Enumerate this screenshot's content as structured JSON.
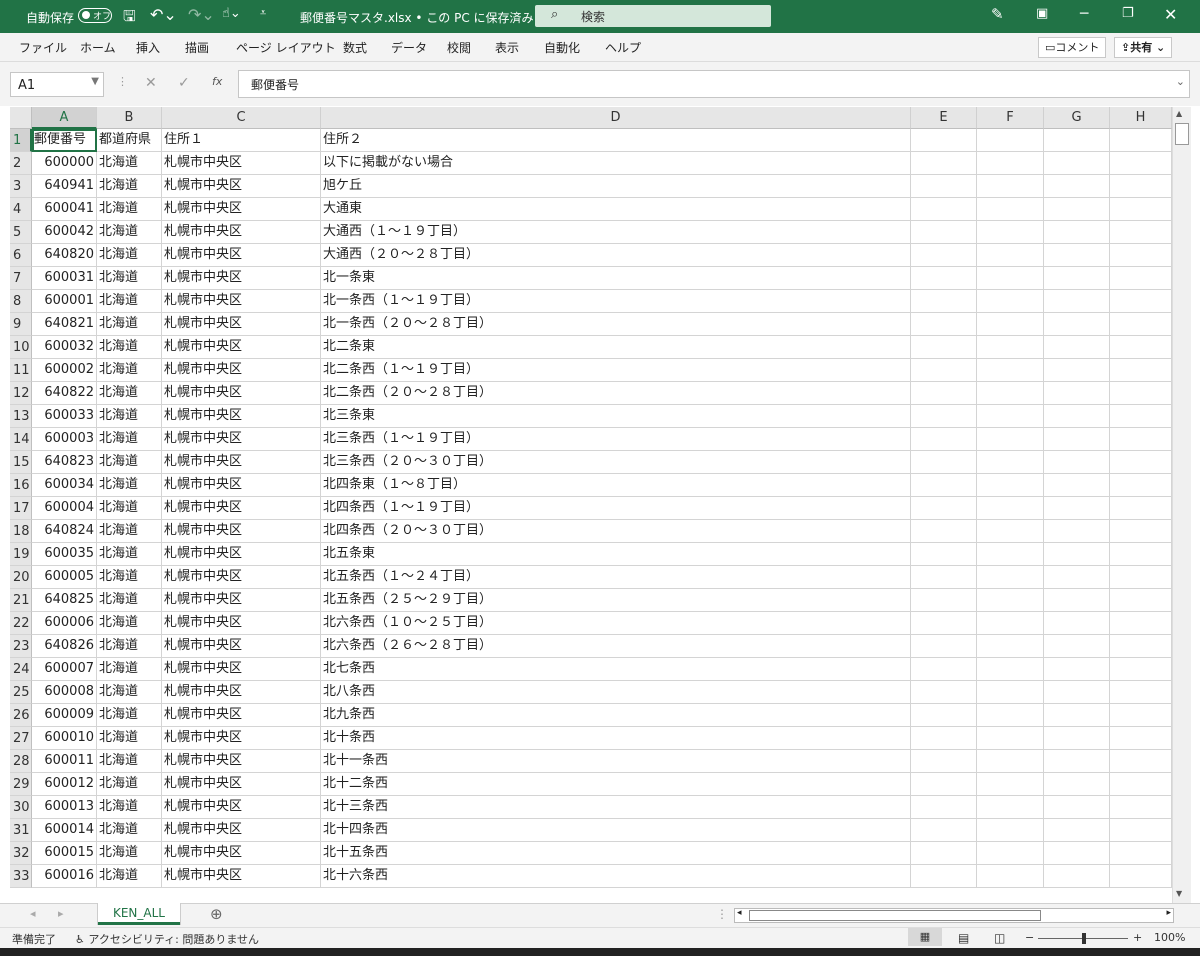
{
  "titlebar": {
    "autosave_label": "自動保存",
    "autosave_state": "オフ",
    "file_title": "郵便番号マスタ.xlsx • この PC に保存済み ⌄",
    "search_placeholder": "検索"
  },
  "ribbon": {
    "menus": [
      "ファイル",
      "ホーム",
      "挿入",
      "描画",
      "ページ レイアウト",
      "数式",
      "データ",
      "校閲",
      "表示",
      "自動化",
      "ヘルプ"
    ],
    "comment_label": "コメント",
    "share_label": "共有"
  },
  "formula_bar": {
    "name_box": "A1",
    "formula": "郵便番号",
    "fx": "fx"
  },
  "columns": [
    "A",
    "B",
    "C",
    "D",
    "E",
    "F",
    "G",
    "H"
  ],
  "selected_cell": "A1",
  "rows": [
    [
      "郵便番号",
      "都道府県",
      "住所１",
      "住所２"
    ],
    [
      "600000",
      "北海道",
      "札幌市中央区",
      "以下に掲載がない場合"
    ],
    [
      "640941",
      "北海道",
      "札幌市中央区",
      "旭ケ丘"
    ],
    [
      "600041",
      "北海道",
      "札幌市中央区",
      "大通東"
    ],
    [
      "600042",
      "北海道",
      "札幌市中央区",
      "大通西（１〜１９丁目）"
    ],
    [
      "640820",
      "北海道",
      "札幌市中央区",
      "大通西（２０〜２８丁目）"
    ],
    [
      "600031",
      "北海道",
      "札幌市中央区",
      "北一条東"
    ],
    [
      "600001",
      "北海道",
      "札幌市中央区",
      "北一条西（１〜１９丁目）"
    ],
    [
      "640821",
      "北海道",
      "札幌市中央区",
      "北一条西（２０〜２８丁目）"
    ],
    [
      "600032",
      "北海道",
      "札幌市中央区",
      "北二条東"
    ],
    [
      "600002",
      "北海道",
      "札幌市中央区",
      "北二条西（１〜１９丁目）"
    ],
    [
      "640822",
      "北海道",
      "札幌市中央区",
      "北二条西（２０〜２８丁目）"
    ],
    [
      "600033",
      "北海道",
      "札幌市中央区",
      "北三条東"
    ],
    [
      "600003",
      "北海道",
      "札幌市中央区",
      "北三条西（１〜１９丁目）"
    ],
    [
      "640823",
      "北海道",
      "札幌市中央区",
      "北三条西（２０〜３０丁目）"
    ],
    [
      "600034",
      "北海道",
      "札幌市中央区",
      "北四条東（１〜８丁目）"
    ],
    [
      "600004",
      "北海道",
      "札幌市中央区",
      "北四条西（１〜１９丁目）"
    ],
    [
      "640824",
      "北海道",
      "札幌市中央区",
      "北四条西（２０〜３０丁目）"
    ],
    [
      "600035",
      "北海道",
      "札幌市中央区",
      "北五条東"
    ],
    [
      "600005",
      "北海道",
      "札幌市中央区",
      "北五条西（１〜２４丁目）"
    ],
    [
      "640825",
      "北海道",
      "札幌市中央区",
      "北五条西（２５〜２９丁目）"
    ],
    [
      "600006",
      "北海道",
      "札幌市中央区",
      "北六条西（１０〜２５丁目）"
    ],
    [
      "640826",
      "北海道",
      "札幌市中央区",
      "北六条西（２６〜２８丁目）"
    ],
    [
      "600007",
      "北海道",
      "札幌市中央区",
      "北七条西"
    ],
    [
      "600008",
      "北海道",
      "札幌市中央区",
      "北八条西"
    ],
    [
      "600009",
      "北海道",
      "札幌市中央区",
      "北九条西"
    ],
    [
      "600010",
      "北海道",
      "札幌市中央区",
      "北十条西"
    ],
    [
      "600011",
      "北海道",
      "札幌市中央区",
      "北十一条西"
    ],
    [
      "600012",
      "北海道",
      "札幌市中央区",
      "北十二条西"
    ],
    [
      "600013",
      "北海道",
      "札幌市中央区",
      "北十三条西"
    ],
    [
      "600014",
      "北海道",
      "札幌市中央区",
      "北十四条西"
    ],
    [
      "600015",
      "北海道",
      "札幌市中央区",
      "北十五条西"
    ],
    [
      "600016",
      "北海道",
      "札幌市中央区",
      "北十六条西"
    ]
  ],
  "sheet_tabs": [
    "KEN_ALL"
  ],
  "status": {
    "ready": "準備完了",
    "accessibility": "アクセシビリティ: 問題ありません",
    "zoom": "100%"
  }
}
